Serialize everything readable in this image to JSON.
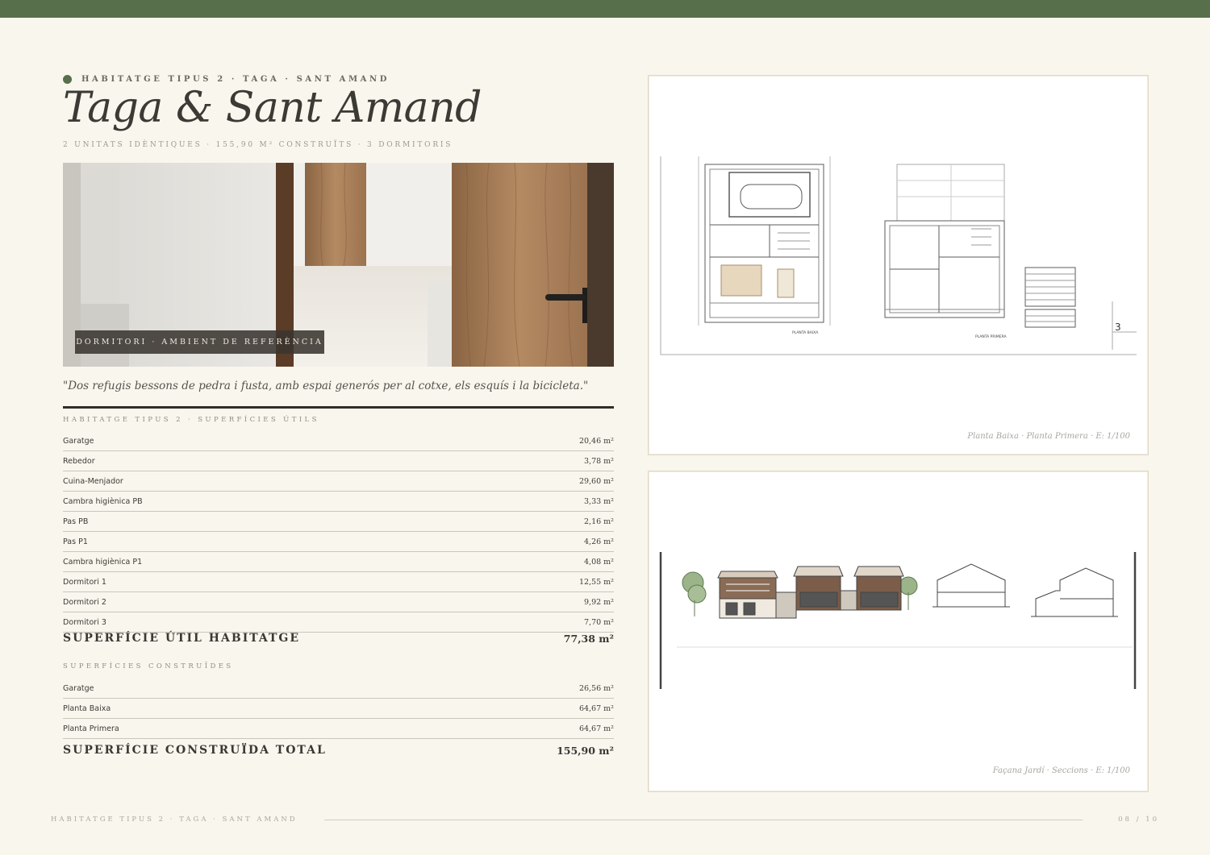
{
  "header": {
    "eyebrow": "HABITATGE TIPUS 2 · TAGA · SANT AMAND",
    "title": "Taga & Sant Amand",
    "subtitle": "2 UNITATS IDÈNTIQUES · 155,90 M² CONSTRUÏTS · 3 DORMITORIS"
  },
  "photo": {
    "caption": "DORMITORI · AMBIENT DE REFERÈNCIA"
  },
  "quote": "\"Dos refugis bessons de pedra i fusta, amb espai generós per al cotxe, els esquís i la bicicleta.\"",
  "useful": {
    "title": "HABITATGE TIPUS 2 · SUPERFÍCIES ÚTILS",
    "rows": [
      {
        "label": "Garatge",
        "value": "20,46 m²"
      },
      {
        "label": "Rebedor",
        "value": "3,78 m²"
      },
      {
        "label": "Cuina-Menjador",
        "value": "29,60 m²"
      },
      {
        "label": "Cambra higiènica PB",
        "value": "3,33 m²"
      },
      {
        "label": "Pas PB",
        "value": "2,16 m²"
      },
      {
        "label": "Pas P1",
        "value": "4,26 m²"
      },
      {
        "label": "Cambra higiènica P1",
        "value": "4,08 m²"
      },
      {
        "label": "Dormitori 1",
        "value": "12,55 m²"
      },
      {
        "label": "Dormitori 2",
        "value": "9,92 m²"
      },
      {
        "label": "Dormitori 3",
        "value": "7,70 m²"
      }
    ],
    "total_label": "SUPERFÍCIE ÚTIL HABITATGE",
    "total_value": "77,38 m²"
  },
  "built": {
    "title": "SUPERFÍCIES CONSTRUÏDES",
    "rows": [
      {
        "label": "Garatge",
        "value": "26,56 m²"
      },
      {
        "label": "Planta Baixa",
        "value": "64,67 m²"
      },
      {
        "label": "Planta Primera",
        "value": "64,67 m²"
      }
    ],
    "total_label": "SUPERFÍCIE CONSTRUÏDA TOTAL",
    "total_value": "155,90 m²"
  },
  "plans": {
    "floor_caption": "Planta Baixa · Planta Primera · E: 1/100",
    "elevation_caption": "Façana Jardí · Seccions · E: 1/100",
    "floor_label_pb": "PLANTA BAIXA",
    "floor_label_p1": "PLANTA PRIMERA",
    "sheet_number": "3"
  },
  "footer": {
    "left": "HABITATGE TIPUS 2 · TAGA · SANT AMAND",
    "right": "08 / 10"
  },
  "colors": {
    "accent": "#586f4c",
    "background": "#f9f6ee"
  }
}
